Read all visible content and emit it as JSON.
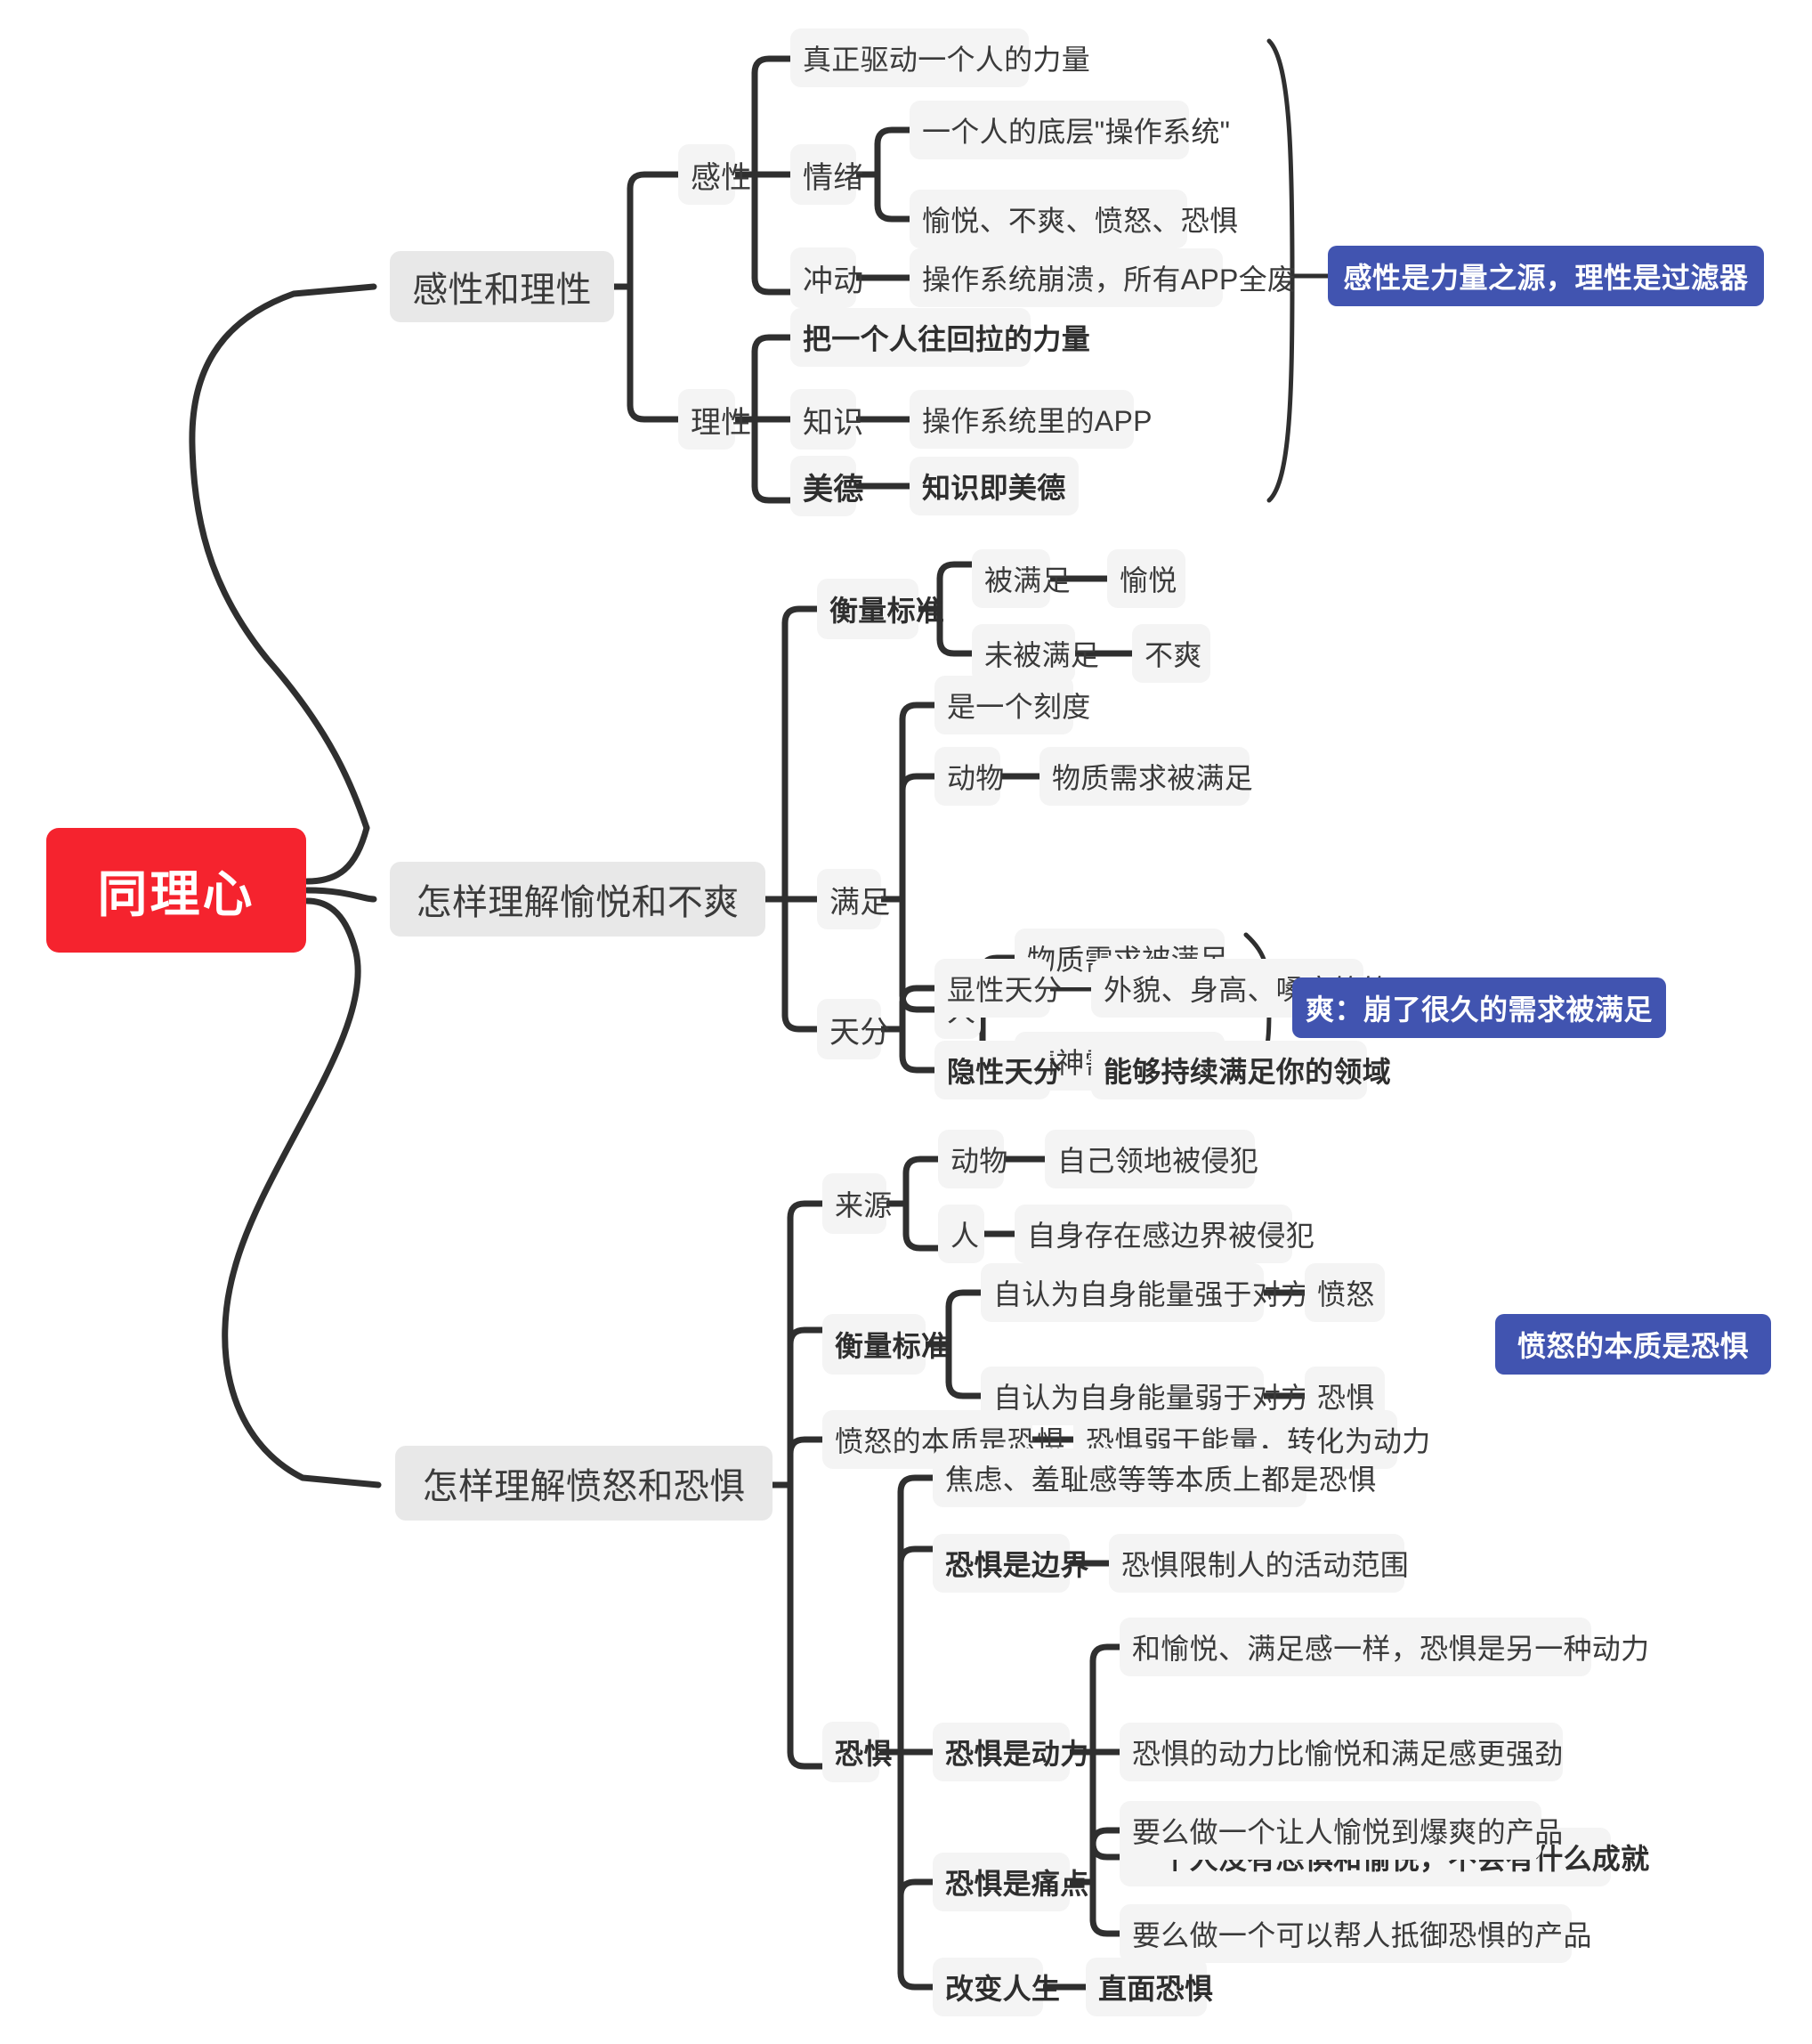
{
  "meta": {
    "diagram_title": "同理心",
    "colors": {
      "root_bg": "#F5232E",
      "root_text": "#FFFFFF",
      "topic_bg": "#E8E8E8",
      "node_bg": "#F4F4F4",
      "node_text": "#3A3A3A",
      "summary_bg": "#4154B0",
      "summary_text": "#FFFFFF",
      "line": "#2F2F2F",
      "canvas_bg": "#FFFFFF"
    }
  },
  "root": {
    "label": "同理心"
  },
  "branches": [
    {
      "id": "branch-1",
      "label": "感性和理性",
      "children": [
        {
          "id": "gan-xing",
          "label": "感性",
          "children": [
            {
              "id": "b1-c1",
              "label": "真正驱动一个人的力量",
              "bold": false,
              "children": []
            },
            {
              "id": "qing-xu",
              "label": "情绪",
              "bold": false,
              "children": [
                {
                  "id": "b1-c2-1",
                  "label": "一个人的底层\"操作系统\"",
                  "bold": false
                },
                {
                  "id": "b1-c2-2",
                  "label": "愉悦、不爽、愤怒、恐惧",
                  "bold": false
                }
              ]
            },
            {
              "id": "chong-dong",
              "label": "冲动",
              "bold": false,
              "children": [
                {
                  "id": "b1-c3-1",
                  "label": "操作系统崩溃，所有APP全废",
                  "bold": false
                }
              ]
            }
          ]
        },
        {
          "id": "li-xing",
          "label": "理性",
          "children": [
            {
              "id": "b1-c4",
              "label": "把一个人往回拉的力量",
              "bold": true,
              "children": []
            },
            {
              "id": "zhi-shi",
              "label": "知识",
              "bold": false,
              "children": [
                {
                  "id": "b1-c5-1",
                  "label": "操作系统里的APP",
                  "bold": false
                }
              ]
            },
            {
              "id": "mei-de",
              "label": "美德",
              "bold": true,
              "children": [
                {
                  "id": "b1-c6-1",
                  "label": "知识即美德",
                  "bold": true
                }
              ]
            }
          ]
        }
      ],
      "summary": {
        "id": "summary-1",
        "label": "感性是力量之源，理性是过滤器"
      }
    },
    {
      "id": "branch-2",
      "label": "怎样理解愉悦和不爽",
      "children": [
        {
          "id": "heng-liang-1",
          "label": "衡量标准",
          "bold": true,
          "children": [
            {
              "id": "b2-c1-1",
              "label": "被满足",
              "bold": false,
              "tail": "愉悦"
            },
            {
              "id": "b2-c1-2",
              "label": "未被满足",
              "bold": false,
              "tail": "不爽"
            }
          ]
        },
        {
          "id": "man-zu",
          "label": "满足",
          "bold": false,
          "children": [
            {
              "id": "b2-c2-1",
              "label": "是一个刻度",
              "bold": false
            },
            {
              "id": "b2-c2-2",
              "label": "动物",
              "bold": false,
              "tail": "物质需求被满足"
            },
            {
              "id": "b2-c2-3",
              "label": "人",
              "bold": false,
              "sub": [
                {
                  "id": "b2-c2-3a",
                  "label": "物质需求被满足"
                },
                {
                  "id": "b2-c2-3b",
                  "label": "精神需求被满足"
                }
              ]
            }
          ]
        },
        {
          "id": "tian-fen",
          "label": "天分",
          "bold": false,
          "children": [
            {
              "id": "b2-c3-1",
              "label": "显性天分",
              "bold": false,
              "tail": "外貌、身高、嗓音等等"
            },
            {
              "id": "b2-c3-2",
              "label": "隐性天分",
              "bold": true,
              "tail": "能够持续满足你的领域",
              "tail_bold": true
            }
          ]
        }
      ],
      "summary": {
        "id": "summary-2",
        "label": "爽：崩了很久的需求被满足"
      }
    },
    {
      "id": "branch-3",
      "label": "怎样理解愤怒和恐惧",
      "children": [
        {
          "id": "lai-yuan",
          "label": "来源",
          "bold": false,
          "children": [
            {
              "id": "b3-c1-1",
              "label": "动物",
              "bold": false,
              "tail": "自己领地被侵犯"
            },
            {
              "id": "b3-c1-2",
              "label": "人",
              "bold": false,
              "tail": "自身存在感边界被侵犯"
            }
          ]
        },
        {
          "id": "heng-liang-2",
          "label": "衡量标准",
          "bold": true,
          "children": [
            {
              "id": "b3-c2-1",
              "label": "自认为自身能量强于对方",
              "bold": false,
              "tail": "愤怒"
            },
            {
              "id": "b3-c2-2",
              "label": "自认为自身能量弱于对方",
              "bold": false,
              "tail": "恐惧"
            }
          ]
        },
        {
          "id": "fen-nu-ben-zhi",
          "label": "愤怒的本质是恐惧",
          "bold": false,
          "children": [
            {
              "id": "b3-c3-1",
              "label": "恐惧弱于能量，转化为动力",
              "bold": false
            }
          ]
        },
        {
          "id": "kong-ju",
          "label": "恐惧",
          "bold": true,
          "children": [
            {
              "id": "b3-c4-1",
              "label": "焦虑、羞耻感等等本质上都是恐惧",
              "bold": false
            },
            {
              "id": "b3-c4-2",
              "label": "恐惧是边界",
              "bold": true,
              "tail": "恐惧限制人的活动范围"
            },
            {
              "id": "b3-c4-3",
              "label": "恐惧是动力",
              "bold": true,
              "sub": [
                {
                  "id": "b3-c4-3a",
                  "label": "和愉悦、满足感一样，恐惧是另一种动力",
                  "bold": false
                },
                {
                  "id": "b3-c4-3b",
                  "label": "恐惧的动力比愉悦和满足感更强劲",
                  "bold": false
                },
                {
                  "id": "b3-c4-3c",
                  "label": "一个人没有恐惧和愉悦，不会有什么成就",
                  "bold": true
                }
              ]
            },
            {
              "id": "b3-c4-4",
              "label": "恐惧是痛点",
              "bold": true,
              "sub": [
                {
                  "id": "b3-c4-4a",
                  "label": "要么做一个让人愉悦到爆爽的产品",
                  "bold": false
                },
                {
                  "id": "b3-c4-4b",
                  "label": "要么做一个可以帮人抵御恐惧的产品",
                  "bold": false
                }
              ]
            },
            {
              "id": "b3-c4-5",
              "label": "改变人生",
              "bold": true,
              "tail": "直面恐惧",
              "tail_bold": true
            }
          ]
        }
      ],
      "summary": {
        "id": "summary-3",
        "label": "愤怒的本质是恐惧"
      }
    }
  ]
}
